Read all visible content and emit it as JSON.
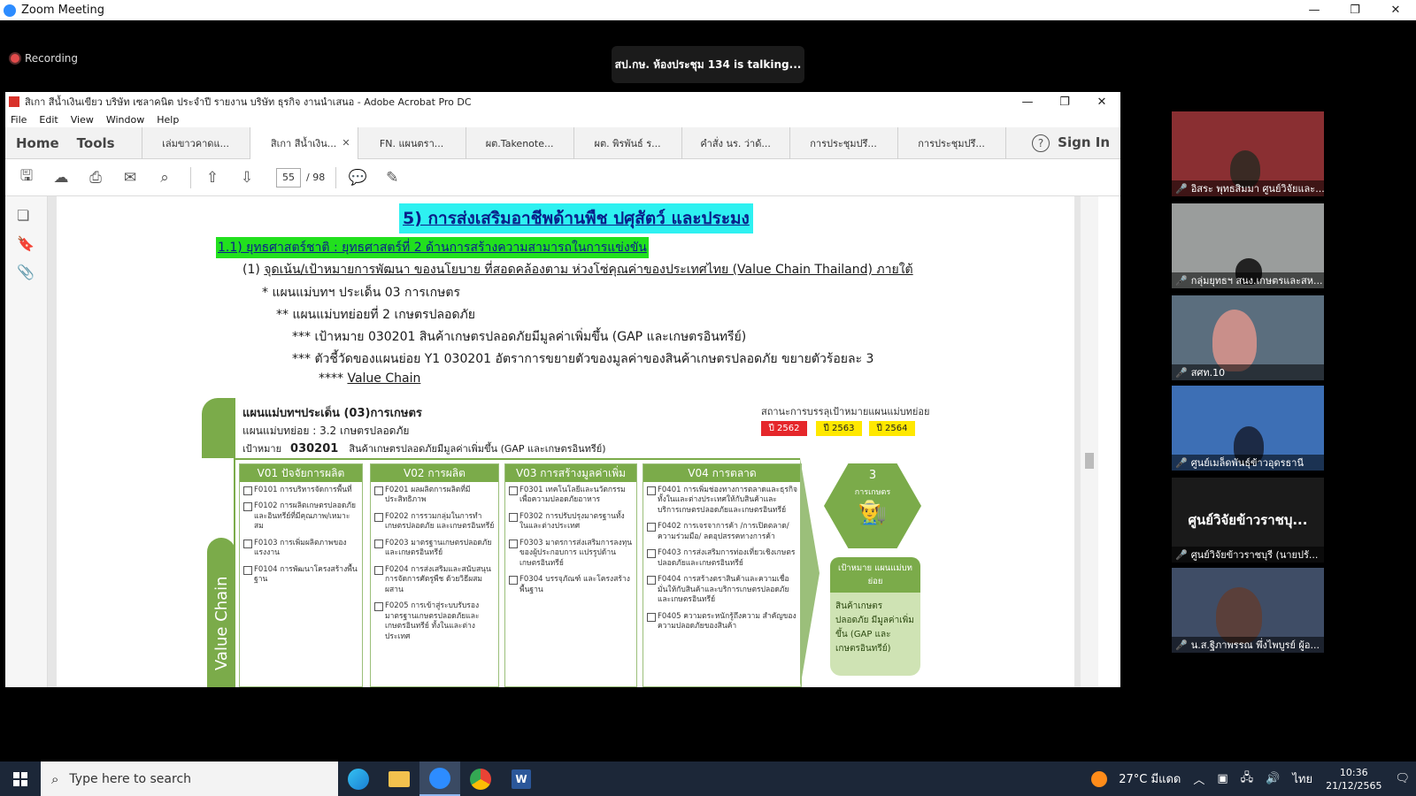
{
  "zoom": {
    "title": "Zoom Meeting",
    "recording": "Recording",
    "talking": "สป.กษ. ห้องประชุม 134 is talking...",
    "window_controls": [
      "—",
      "❐",
      "✕"
    ]
  },
  "acrobat": {
    "title": "สิเกา สีน้ำเงินเขียว บริษัท เซลาคนิต ประจำปี รายงาน บริษัท ธุรกิจ งานนำเสนอ - Adobe Acrobat Pro DC",
    "menu": [
      "File",
      "Edit",
      "View",
      "Window",
      "Help"
    ],
    "home": "Home",
    "tools": "Tools",
    "tabs": [
      "เล่มขาวคาดแ...",
      "สิเกา สีน้ำเงิน...",
      "FN. แผนตรา...",
      "ผต.Takenote...",
      "ผต. พิรพันธ์ ร...",
      "คำสั่ง นร. ว่าด้...",
      "การประชุมปรึ...",
      "การประชุมปรึ..."
    ],
    "help_icon": "?",
    "sign_in": "Sign In",
    "page_current": "55",
    "page_total": "/ 98"
  },
  "document": {
    "title": "5) การส่งเสริมอาชีพด้านพืช ปศุสัตว์ และประมง",
    "strategy": "1.1) ยุทธศาสตร์ชาติ : ยุทธศาสตร์ที่ 2 ด้านการสร้างความสามารถในการแข่งขัน",
    "line1_prefix": "(1)",
    "line1": "จุดเน้น/เป้าหมายการพัฒนา ของนโยบาย ที่สอดคล้องตาม ห่วงโซ่คุณค่าของประเทศไทย (Value Chain Thailand) ภายใต้",
    "line2": "* แผนแม่บทฯ ประเด็น 03 การเกษตร",
    "line3": "** แผนแม่บทย่อยที่ 2 เกษตรปลอดภัย",
    "line4": "*** เป้าหมาย 030201 สินค้าเกษตรปลอดภัยมีมูลค่าเพิ่มขึ้น (GAP และเกษตรอินทรีย์)",
    "line5": "*** ตัวชี้วัดของแผนย่อย Y1 030201 อัตราการขยายตัวของมูลค่าของสินค้าเกษตรปลอดภัย ขยายตัวร้อยละ 3",
    "line6_prefix": "****",
    "line6": "Value Chain"
  },
  "infographic": {
    "head1": "แผนแม่บทฯประเด็น (03)การเกษตร",
    "head2": "แผนแม่บทย่อย : 3.2 เกษตรปลอดภัย",
    "head3_label": "เป้าหมาย",
    "head3_code": "030201",
    "head3_text": "สินค้าเกษตรปลอดภัยมีมูลค่าเพิ่มขึ้น (GAP และเกษตรอินทรีย์)",
    "status_label": "สถานะการบรรลุเป้าหมายแผนแม่บทย่อย",
    "years": [
      {
        "label": "ปี 2562",
        "color": "#e5272b",
        "text_color": "#ffffff"
      },
      {
        "label": "ปี 2563",
        "color": "#ffe800",
        "text_color": "#222222"
      },
      {
        "label": "ปี 2564",
        "color": "#ffe800",
        "text_color": "#222222"
      }
    ],
    "side_label": "Value Chain",
    "columns": [
      {
        "title": "V01 ปัจจัยการผลิต",
        "items": [
          "F0101 การบริหารจัดการพื้นที่",
          "F0102 การผลิตเกษตรปลอดภัยและอินทรีย์ที่มีคุณภาพ/เหมาะสม",
          "F0103 การเพิ่มผลิตภาพของแรงงาน",
          "F0104 การพัฒนาโครงสร้างพื้นฐาน"
        ]
      },
      {
        "title": "V02 การผลิต",
        "items": [
          "F0201 ผลผลิตการผลิตที่มีประสิทธิภาพ",
          "F0202 การรวมกลุ่มในการทำเกษตรปลอดภัย และเกษตรอินทรีย์",
          "F0203 มาตรฐานเกษตรปลอดภัยและเกษตรอินทรีย์",
          "F0204 การส่งเสริมและสนับสนุนการจัดการศัตรูพืช ด้วยวิธีผสมผสาน",
          "F0205 การเข้าสู่ระบบรับรองมาตรฐานเกษตรปลอดภัยและเกษตรอินทรีย์ ทั้งในและต่างประเทศ"
        ]
      },
      {
        "title": "V03 การสร้างมูลค่าเพิ่ม",
        "items": [
          "F0301 เทคโนโลยีและนวัตกรรมเพื่อความปลอดภัยอาหาร",
          "F0302 การปรับปรุงมาตรฐานทั้งในและต่างประเทศ",
          "F0303 มาตรการส่งเสริมการลงทุนของผู้ประกอบการ แปรรูปด้านเกษตรอินทรีย์",
          "F0304 บรรจุภัณฑ์ และโครงสร้างพื้นฐาน"
        ]
      },
      {
        "title": "V04 การตลาด",
        "items": [
          "F0401 การเพิ่มช่องทางการตลาดและธุรกิจทั้งในและต่างประเทศให้กับสินค้าและบริการเกษตรปลอดภัยและเกษตรอินทรีย์",
          "F0402 การเจรจาการค้า /การเปิดตลาด/ ความร่วมมือ/ ลดอุปสรรคทางการค้า",
          "F0403 การส่งเสริมการท่องเที่ยวเชิงเกษตรปลอดภัยและเกษตรอินทรีย์",
          "F0404 การสร้างตราสินค้าและความเชื่อมั่นให้กับสินค้าและบริการเกษตรปลอดภัยและเกษตรอินทรีย์",
          "F0405 ความตระหนักรู้ถึงความ สำคัญของความปลอดภัยของสินค้า"
        ]
      }
    ],
    "hex_number": "3",
    "hex_text": "การเกษตร",
    "goal_head": "เป้าหมาย แผนแม่บทย่อย",
    "goal_text": "สินค้าเกษตรปลอดภัย มีมูลค่าเพิ่มขึ้น (GAP และเกษตรอินทรีย์)"
  },
  "participants": [
    {
      "name": "อิสระ พุทธสิมมา ศูนย์วิจัยและ...",
      "bg": "#8a2f32"
    },
    {
      "name": "กลุ่มยุทธฯ สนง.เกษตรและสห...",
      "bg": "#9a9d9c"
    },
    {
      "name": "สศท.10",
      "bg": "#5b6e7e"
    },
    {
      "name": "ศูนย์เมล็ดพันธุ์ข้าวอุดรธานี",
      "bg": "#3d6fb5"
    },
    {
      "name": "ศูนย์วิจัยข้าวราชบุรี (นายปรั...",
      "bg": "#1a1a1a",
      "big": "ศูนย์วิจัยข้าวราชบุ..."
    },
    {
      "name": "น.ส.ฐิภาพรรณ พึ่งไพบูรย์ ผู้อ...",
      "bg": "#3f4d66"
    }
  ],
  "taskbar": {
    "search_placeholder": "Type here to search",
    "weather": "27°C มีแดด",
    "lang": "ไทย",
    "time": "10:36",
    "date": "21/12/2565"
  }
}
